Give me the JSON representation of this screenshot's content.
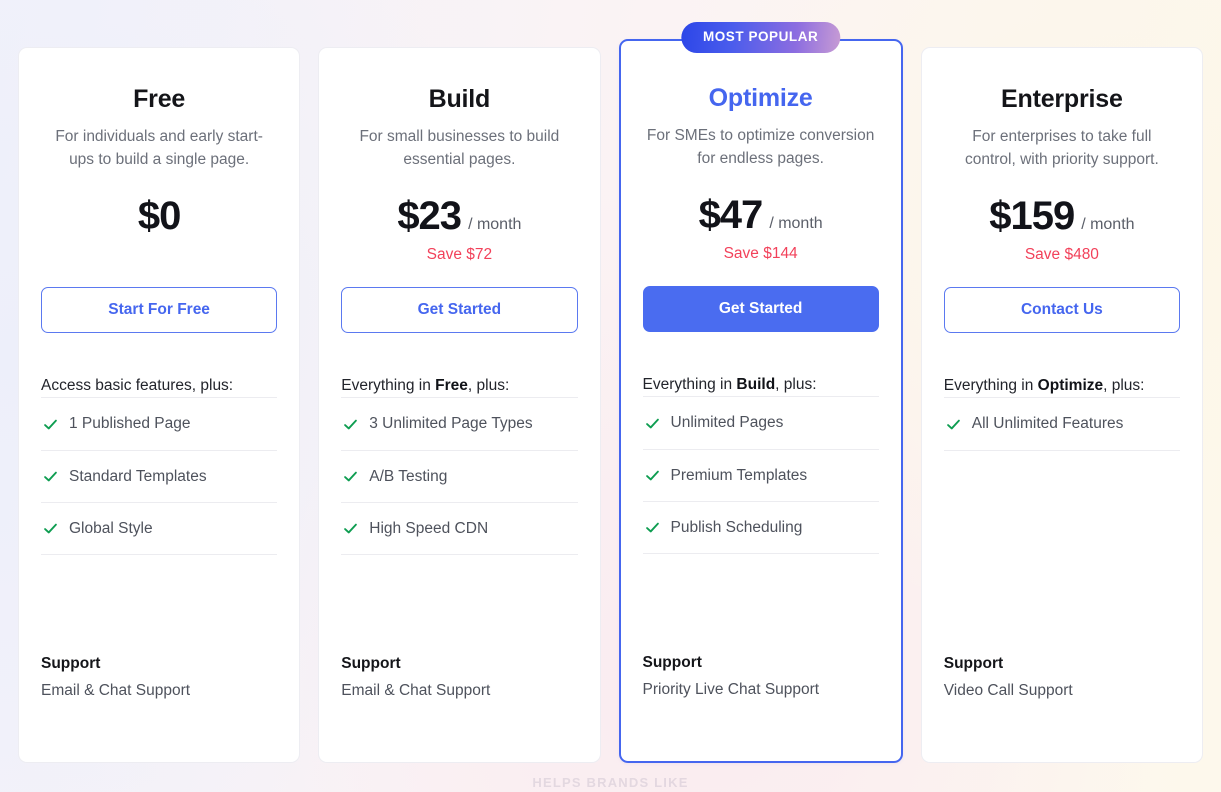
{
  "page": {
    "background_left": "#EEF0FA",
    "background_mid": "#FAEEF2",
    "background_right": "#FDF8EC",
    "accent_color": "#4566EF",
    "save_color": "#F2415A",
    "check_color": "#0E9D51",
    "partial_below_text": "HELPS BRANDS LIKE"
  },
  "badge": {
    "label": "MOST POPULAR",
    "gradient_from": "#2C46E8",
    "gradient_to": "#C79BD4"
  },
  "plans": [
    {
      "name": "Free",
      "description": "For individuals and early start-ups to build a single page.",
      "price": "$0",
      "period": "",
      "save": "",
      "cta_label": "Start For Free",
      "cta_style": "outline",
      "featured": false,
      "features_intro_prefix": "Access basic features, plus:",
      "features_intro_bold": "",
      "features_intro_suffix": "",
      "features": [
        "1 Published Page",
        "Standard Templates",
        "Global Style"
      ],
      "support_title": "Support",
      "support_value": "Email & Chat Support"
    },
    {
      "name": "Build",
      "description": "For small businesses to build essential pages.",
      "price": "$23",
      "period": "/ month",
      "save": "Save $72",
      "cta_label": "Get Started",
      "cta_style": "outline",
      "featured": false,
      "features_intro_prefix": "Everything in ",
      "features_intro_bold": "Free",
      "features_intro_suffix": ", plus:",
      "features": [
        "3 Unlimited Page Types",
        "A/B Testing",
        "High Speed CDN"
      ],
      "support_title": "Support",
      "support_value": "Email & Chat Support"
    },
    {
      "name": "Optimize",
      "description": "For SMEs to optimize conversion for endless pages.",
      "price": "$47",
      "period": "/ month",
      "save": "Save $144",
      "cta_label": "Get Started",
      "cta_style": "primary",
      "featured": true,
      "features_intro_prefix": "Everything in ",
      "features_intro_bold": "Build",
      "features_intro_suffix": ", plus:",
      "features": [
        "Unlimited Pages",
        "Premium Templates",
        "Publish Scheduling"
      ],
      "support_title": "Support",
      "support_value": "Priority Live Chat Support"
    },
    {
      "name": "Enterprise",
      "description": "For enterprises to take full control, with priority support.",
      "price": "$159",
      "period": "/ month",
      "save": "Save $480",
      "cta_label": "Contact Us",
      "cta_style": "outline",
      "featured": false,
      "features_intro_prefix": "Everything in ",
      "features_intro_bold": "Optimize",
      "features_intro_suffix": ", plus:",
      "features": [
        "All Unlimited Features"
      ],
      "support_title": "Support",
      "support_value": "Video Call Support"
    }
  ]
}
